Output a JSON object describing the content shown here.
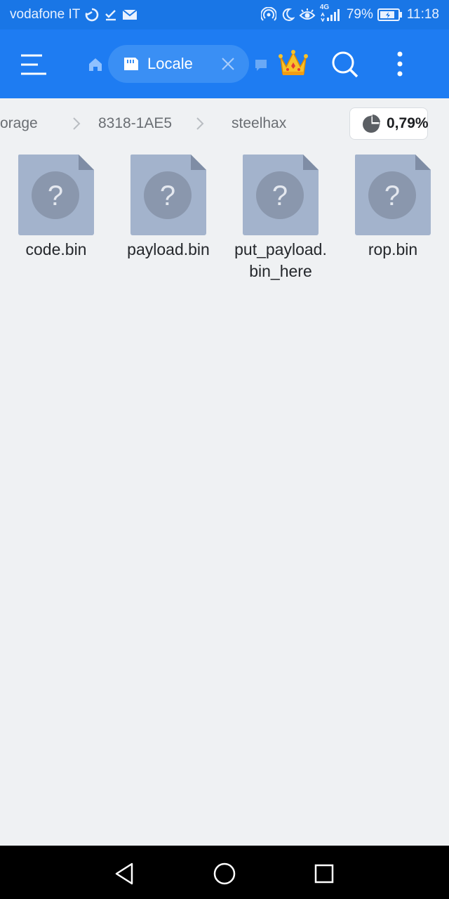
{
  "status_bar": {
    "carrier": "vodafone IT",
    "network": "4G",
    "battery": "79%",
    "time": "11:18",
    "icons_left": [
      "data-saver-icon",
      "download-done-icon",
      "mail-icon"
    ],
    "icons_right": [
      "hotspot-icon",
      "moon-icon",
      "eye-icon",
      "signal-icon",
      "battery-icon"
    ]
  },
  "toolbar": {
    "menu_icon": "hamburger-menu-icon",
    "home_icon": "home-icon",
    "current_tab": "Locale",
    "tab_icon": "sd-card-icon",
    "close_icon": "close-icon",
    "second_tab_icon": "tab-icon",
    "premium_icon": "crown-icon",
    "search_icon": "search-icon",
    "more_icon": "more-vertical-icon",
    "colors": {
      "bar": "#1e7cf2",
      "status": "#1976e6",
      "pill": "#3a8ff4"
    }
  },
  "breadcrumb": {
    "items": [
      "orage",
      "8318-1AE5",
      "steelhax"
    ],
    "usage_percent": "0,79%",
    "usage_icon": "pie-chart-icon"
  },
  "files": [
    {
      "name": "code.bin",
      "icon": "unknown-file-icon"
    },
    {
      "name": "payload.bin",
      "icon": "unknown-file-icon"
    },
    {
      "name": "put_payload.bin_here",
      "icon": "unknown-file-icon"
    },
    {
      "name": "rop.bin",
      "icon": "unknown-file-icon"
    }
  ],
  "nav_bar": {
    "back_icon": "back-triangle-icon",
    "home_icon": "home-circle-icon",
    "recents_icon": "recents-square-icon"
  }
}
